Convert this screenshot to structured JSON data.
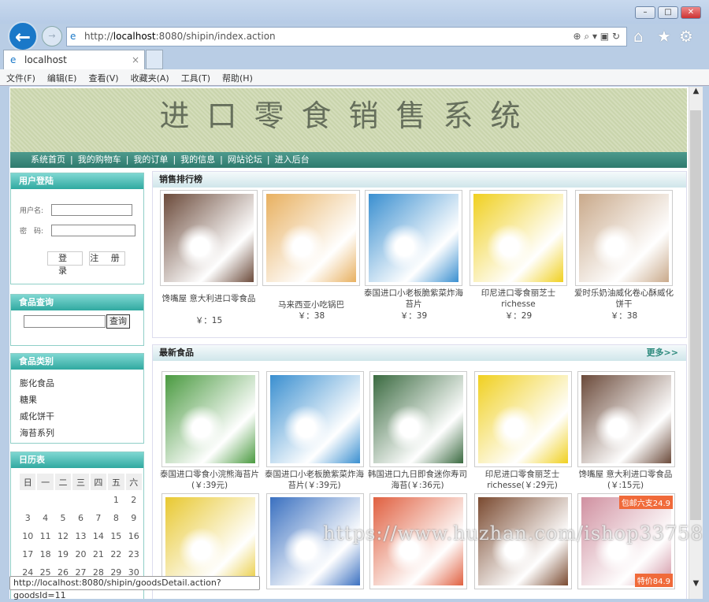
{
  "browser": {
    "url_prefix": "http://",
    "url_host": "localhost",
    "url_rest": ":8080/shipin/index.action",
    "tab_title": "localhost",
    "tab_close": "×",
    "menu": [
      "文件(F)",
      "编辑(E)",
      "查看(V)",
      "收藏夹(A)",
      "工具(T)",
      "帮助(H)"
    ],
    "status_url": "http://localhost:8080/shipin/goodsDetail.action?goodsId=11"
  },
  "site": {
    "title": "进口零食销售系统",
    "nav": [
      "系统首页",
      "我的购物车",
      "我的订单",
      "我的信息",
      "网站论坛",
      "进入后台"
    ],
    "nav_sep": "|"
  },
  "login": {
    "title": "用户登陆",
    "username_label": "用户名:",
    "password_label": "密　码:",
    "username_value": "",
    "password_value": "",
    "login_btn": "登 录",
    "register_btn": "注 册"
  },
  "search": {
    "title": "食品查询",
    "value": "",
    "button": "查询"
  },
  "categories": {
    "title": "食品类别",
    "items": [
      "膨化食品",
      "糖果",
      "威化饼干",
      "海苔系列"
    ]
  },
  "calendar": {
    "title": "日历表",
    "weekdays": [
      "日",
      "一",
      "二",
      "三",
      "四",
      "五",
      "六"
    ],
    "weeks": [
      [
        "",
        "",
        "",
        "",
        "",
        "1",
        "2"
      ],
      [
        "3",
        "4",
        "5",
        "6",
        "7",
        "8",
        "9"
      ],
      [
        "10",
        "11",
        "12",
        "13",
        "14",
        "15",
        "16"
      ],
      [
        "17",
        "18",
        "19",
        "20",
        "21",
        "22",
        "23"
      ],
      [
        "24",
        "25",
        "26",
        "27",
        "28",
        "29",
        "30"
      ]
    ]
  },
  "bestsellers": {
    "title": "销售排行榜",
    "items": [
      {
        "name": "馋嘴屋 意大利进口零食品",
        "price": "￥：15",
        "color": "#6b4a3a"
      },
      {
        "name": "马来西亚小吃锅巴",
        "price": "￥：38",
        "color": "#e8b060"
      },
      {
        "name": "泰国进口小老板脆紫菜炸海苔片",
        "price": "￥：39",
        "color": "#3a8fd0"
      },
      {
        "name": "印尼进口零食丽芝士richesse",
        "price": "￥：29",
        "color": "#f0d020"
      },
      {
        "name": "爱时乐奶油威化卷心酥威化饼干",
        "price": "￥：38",
        "color": "#c9a98a"
      }
    ]
  },
  "latest": {
    "title": "最新食品",
    "more": "更多>>",
    "items": [
      {
        "name": "泰国进口零食小浣熊海苔片(￥:39元)",
        "color": "#4a9a40"
      },
      {
        "name": "泰国进口小老板脆紫菜炸海苔片(￥:39元)",
        "color": "#3a8fd0"
      },
      {
        "name": "韩国进口九日即食迷你寿司海苔(￥:36元)",
        "color": "#3a6a40"
      },
      {
        "name": "印尼进口零食丽芝士richesse(￥:29元)",
        "color": "#f0d020"
      },
      {
        "name": "馋嘴屋 意大利进口零食品(￥:15元)",
        "color": "#6b4a3a"
      }
    ],
    "row2": [
      {
        "color": "#e8c830"
      },
      {
        "color": "#3a70c0"
      },
      {
        "color": "#e06040"
      },
      {
        "color": "#7a4a30"
      },
      {
        "color": "#d090a0",
        "badge_top": "包邮六支24.9",
        "badge_bottom": "特价84.9"
      }
    ]
  },
  "watermark": "https://www.huzhan.com/ishop33758"
}
